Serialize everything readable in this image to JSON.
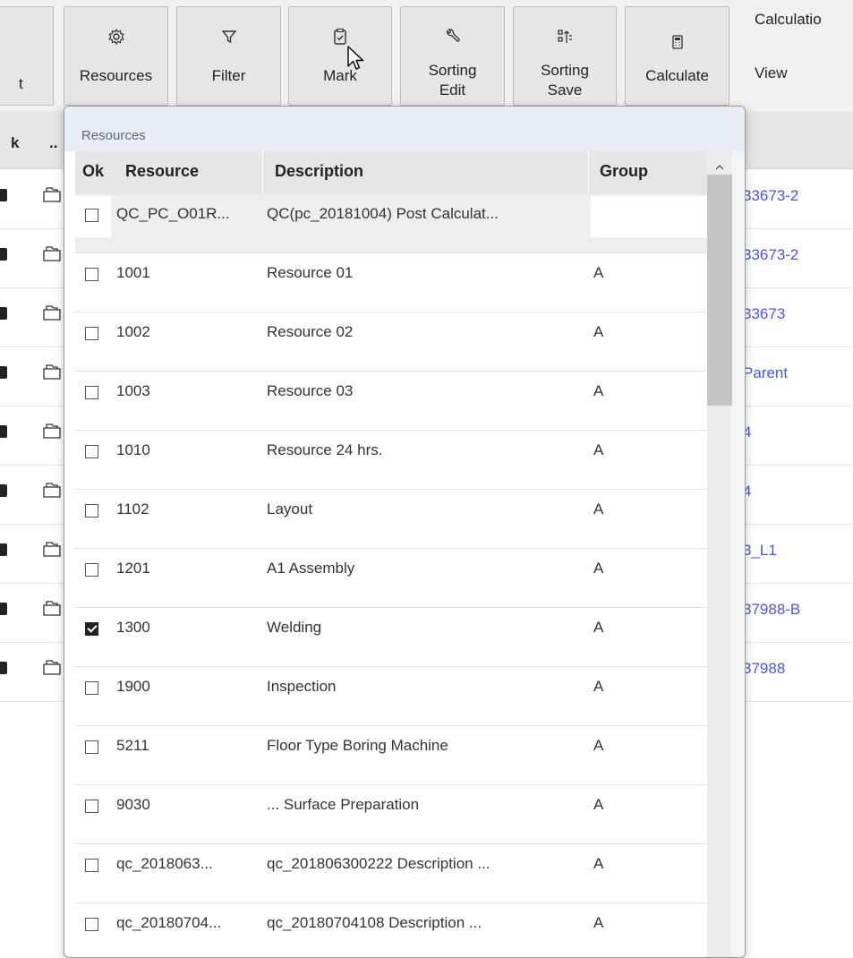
{
  "toolbar": {
    "partial_label": "t",
    "buttons": [
      {
        "label": "Resources",
        "icon": "gear-icon"
      },
      {
        "label": "Filter",
        "icon": "filter-icon"
      },
      {
        "label": "Mark",
        "icon": "clipboard-check-icon"
      },
      {
        "label": "Sorting Edit",
        "icon": "wrench-icon"
      },
      {
        "label": "Sorting Save",
        "icon": "sort-save-icon"
      },
      {
        "label": "Calculate",
        "icon": "calculator-icon"
      }
    ],
    "calculation_caption": "Calculatio",
    "view_label": "View"
  },
  "background_grid": {
    "header_col1": "k",
    "header_col2": "..",
    "row_links": [
      "33673-2",
      "33673-2",
      "33673",
      "Parent",
      "4",
      "4",
      "3_L1",
      "37988-B",
      "37988"
    ]
  },
  "popup": {
    "title": "Resources",
    "columns": {
      "ok": "Ok",
      "resource": "Resource",
      "description": "Description",
      "group": "Group"
    },
    "rows": [
      {
        "checked": false,
        "resource": "QC_PC_O01R...",
        "description": "QC(pc_20181004) Post Calculat...",
        "group": ""
      },
      {
        "checked": false,
        "resource": "1001",
        "description": "Resource 01",
        "group": "A"
      },
      {
        "checked": false,
        "resource": "1002",
        "description": "Resource 02",
        "group": "A"
      },
      {
        "checked": false,
        "resource": "1003",
        "description": "Resource 03",
        "group": "A"
      },
      {
        "checked": false,
        "resource": "1010",
        "description": "Resource 24 hrs.",
        "group": "A"
      },
      {
        "checked": false,
        "resource": "1102",
        "description": "Layout",
        "group": "A"
      },
      {
        "checked": false,
        "resource": "1201",
        "description": "A1 Assembly",
        "group": "A"
      },
      {
        "checked": true,
        "resource": "1300",
        "description": "Welding",
        "group": "A"
      },
      {
        "checked": false,
        "resource": "1900",
        "description": "Inspection",
        "group": "A"
      },
      {
        "checked": false,
        "resource": "5211",
        "description": "Floor Type Boring Machine",
        "group": "A"
      },
      {
        "checked": false,
        "resource": "9030",
        "description": "... Surface Preparation",
        "group": "A"
      },
      {
        "checked": false,
        "resource": "qc_2018063...",
        "description": "qc_201806300222 Description ...",
        "group": "A"
      },
      {
        "checked": false,
        "resource": "qc_20180704...",
        "description": "qc_20180704108 Description ...",
        "group": "A"
      }
    ]
  },
  "colors": {
    "link": "#4a55e6",
    "popup_title_bg": "#e8eef6",
    "header_bg": "#e6e6e6"
  }
}
